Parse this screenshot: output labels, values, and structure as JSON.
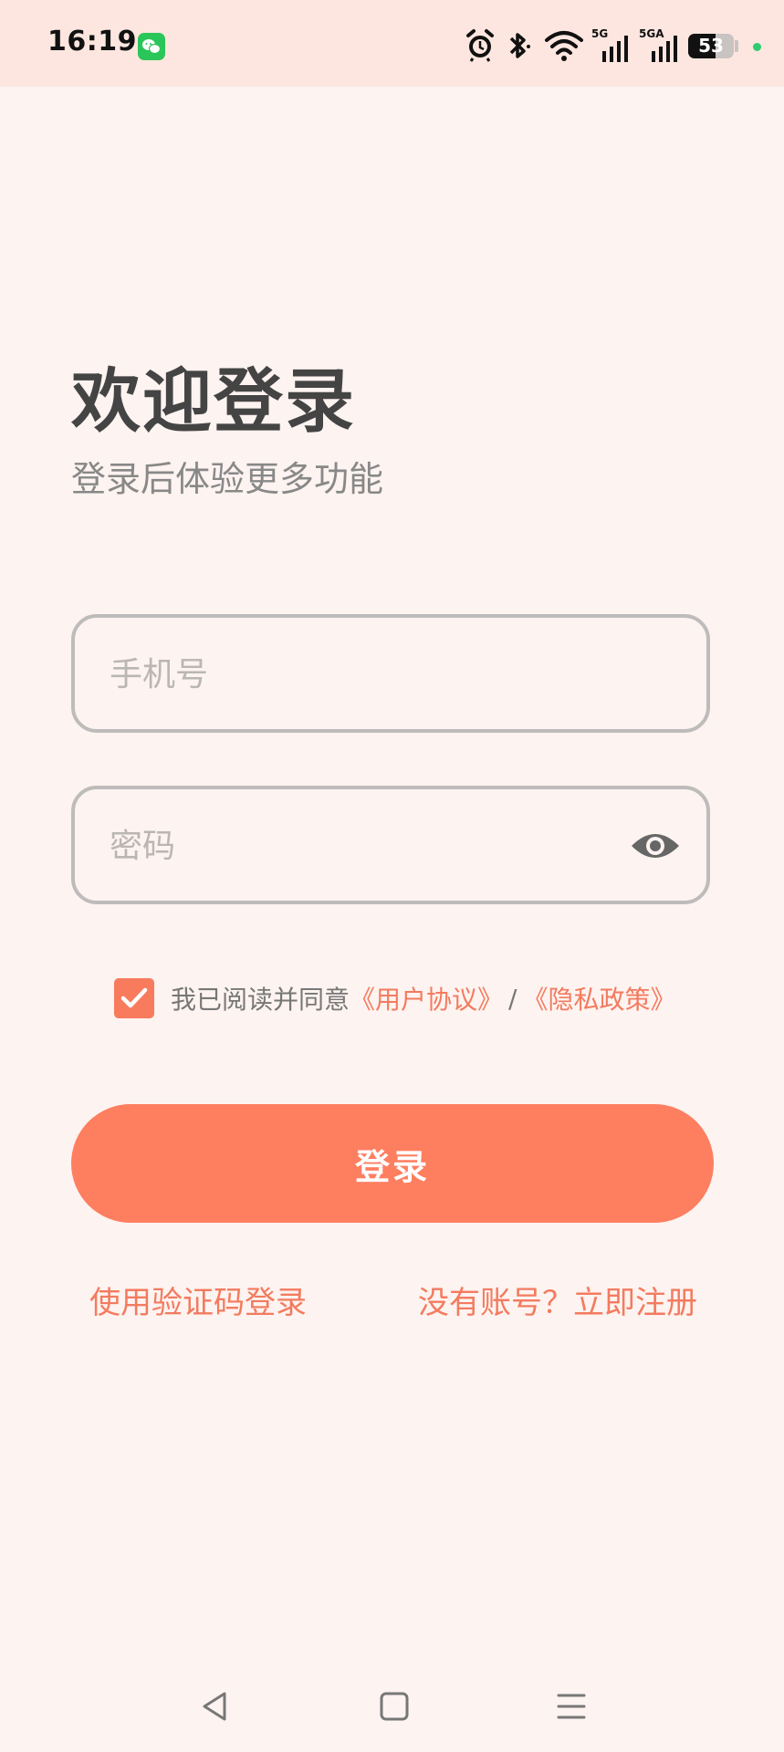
{
  "status_bar": {
    "time": "16:19",
    "app_icon": "wechat-icon",
    "icons": [
      "alarm-icon",
      "bluetooth-icon",
      "wifi-icon",
      "signal-5g-icon",
      "signal-5ga-icon"
    ],
    "signal1_label": "5G",
    "signal2_label": "5GA",
    "battery_level": "53",
    "colors": {
      "background": "#fde6df",
      "battery_dot": "#2ecc71"
    }
  },
  "header": {
    "title": "欢迎登录",
    "subtitle": "登录后体验更多功能"
  },
  "form": {
    "phone_placeholder": "手机号",
    "phone_value": "",
    "password_placeholder": "密码",
    "password_value": "",
    "password_toggle_icon": "eye-icon"
  },
  "agreement": {
    "checked": true,
    "prefix": "我已阅读并同意",
    "user_agreement": "《用户协议》",
    "separator": "/",
    "privacy_policy": "《隐私政策》"
  },
  "actions": {
    "login_label": "登录",
    "code_login_label": "使用验证码登录",
    "register_label": "没有账号？立即注册"
  },
  "nav_bar": {
    "icons": [
      "back-icon",
      "home-icon",
      "menu-icon"
    ]
  },
  "colors": {
    "accent": "#fe7e60",
    "link": "#f37b5f",
    "background": "#fdf3f0"
  }
}
